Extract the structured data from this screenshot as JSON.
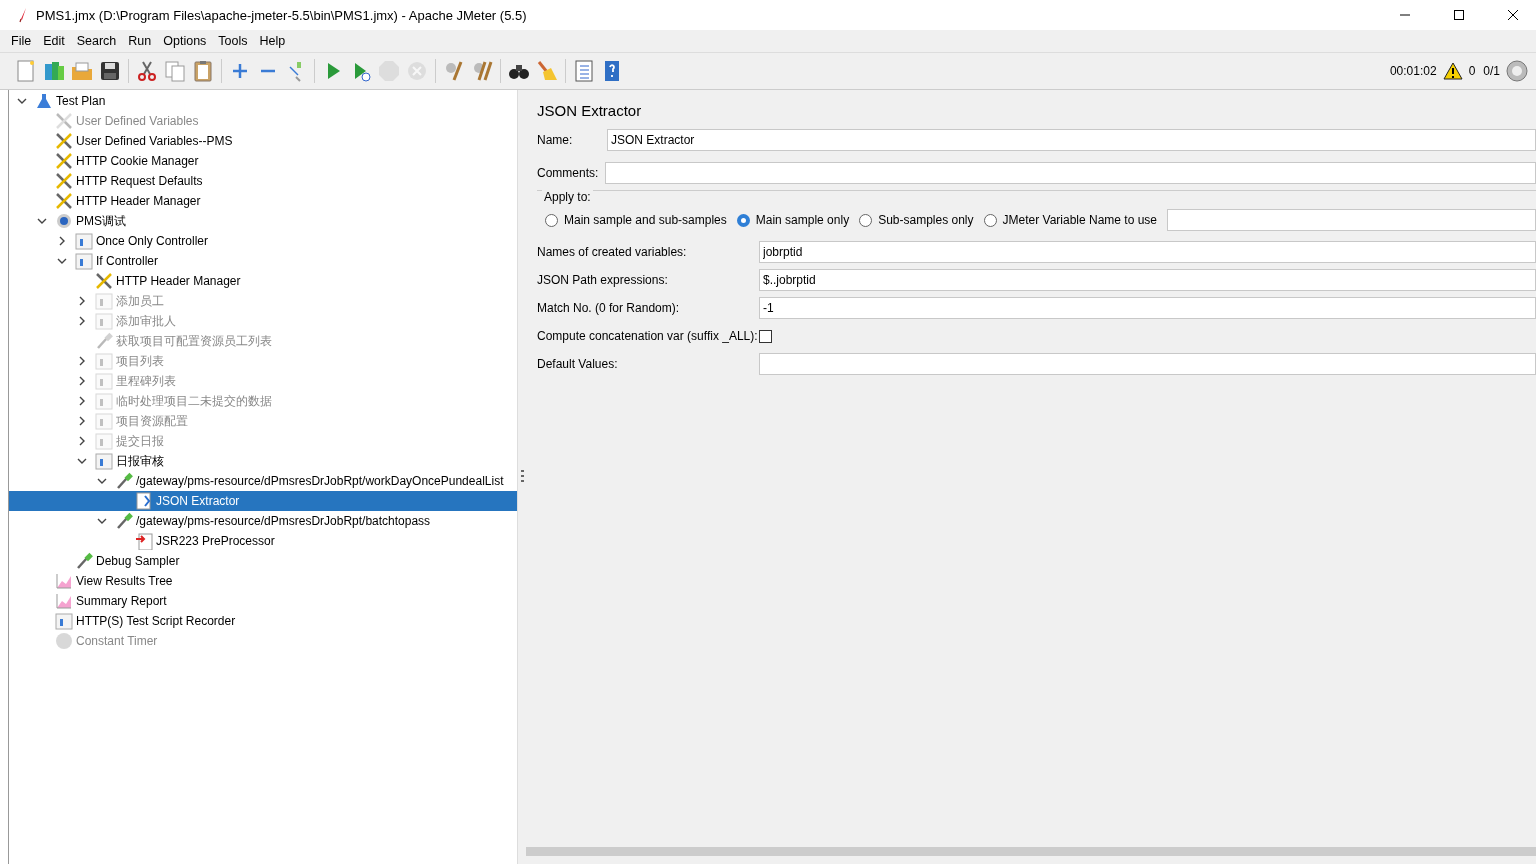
{
  "window": {
    "title": "PMS1.jmx (D:\\Program Files\\apache-jmeter-5.5\\bin\\PMS1.jmx) - Apache JMeter (5.5)"
  },
  "menu": [
    "File",
    "Edit",
    "Search",
    "Run",
    "Options",
    "Tools",
    "Help"
  ],
  "toolbar": [
    {
      "kind": "new",
      "disabled": false
    },
    {
      "kind": "templates",
      "disabled": false
    },
    {
      "kind": "open",
      "disabled": false
    },
    {
      "kind": "save",
      "disabled": false
    },
    {
      "kind": "sep"
    },
    {
      "kind": "cut",
      "disabled": false
    },
    {
      "kind": "copy",
      "disabled": false
    },
    {
      "kind": "paste",
      "disabled": false
    },
    {
      "kind": "sep"
    },
    {
      "kind": "expand",
      "disabled": false
    },
    {
      "kind": "collapse",
      "disabled": false
    },
    {
      "kind": "toggle",
      "disabled": false
    },
    {
      "kind": "sep"
    },
    {
      "kind": "start",
      "disabled": false
    },
    {
      "kind": "start-no-pause",
      "disabled": false
    },
    {
      "kind": "stop",
      "disabled": true
    },
    {
      "kind": "shutdown",
      "disabled": true
    },
    {
      "kind": "sep"
    },
    {
      "kind": "clear",
      "disabled": false
    },
    {
      "kind": "clear-all",
      "disabled": false
    },
    {
      "kind": "sep"
    },
    {
      "kind": "search",
      "disabled": false
    },
    {
      "kind": "reset",
      "disabled": false
    },
    {
      "kind": "sep"
    },
    {
      "kind": "functions",
      "disabled": false
    },
    {
      "kind": "help",
      "disabled": false
    }
  ],
  "status": {
    "elapsed": "00:01:02",
    "warnings": "0",
    "threads": "0/1"
  },
  "tree": [
    {
      "label": "Test Plan",
      "kind": "plan",
      "disabled": false,
      "selected": false,
      "expanded": true,
      "children": [
        {
          "label": "User Defined Variables",
          "kind": "config",
          "disabled": true,
          "selected": false
        },
        {
          "label": "User Defined Variables--PMS",
          "kind": "config",
          "disabled": false,
          "selected": false
        },
        {
          "label": "HTTP Cookie Manager",
          "kind": "config",
          "disabled": false,
          "selected": false
        },
        {
          "label": "HTTP Request Defaults",
          "kind": "config",
          "disabled": false,
          "selected": false
        },
        {
          "label": "HTTP Header Manager",
          "kind": "config",
          "disabled": false,
          "selected": false
        },
        {
          "label": "PMS调试",
          "kind": "threadgroup",
          "disabled": false,
          "selected": false,
          "expanded": true,
          "children": [
            {
              "label": "Once Only Controller",
              "kind": "controller",
              "disabled": false,
              "selected": false,
              "expanded": false
            },
            {
              "label": "If Controller",
              "kind": "controller",
              "disabled": false,
              "selected": false,
              "expanded": true,
              "children": [
                {
                  "label": "HTTP Header Manager",
                  "kind": "config",
                  "disabled": false,
                  "selected": false
                },
                {
                  "label": "添加员工",
                  "kind": "controller",
                  "disabled": true,
                  "selected": false,
                  "expanded": false
                },
                {
                  "label": "添加审批人",
                  "kind": "controller",
                  "disabled": true,
                  "selected": false,
                  "expanded": false
                },
                {
                  "label": "获取项目可配置资源员工列表",
                  "kind": "sampler",
                  "disabled": true,
                  "selected": false
                },
                {
                  "label": "项目列表",
                  "kind": "controller",
                  "disabled": true,
                  "selected": false,
                  "expanded": false
                },
                {
                  "label": "里程碑列表",
                  "kind": "controller",
                  "disabled": true,
                  "selected": false,
                  "expanded": false
                },
                {
                  "label": "临时处理项目二未提交的数据",
                  "kind": "controller",
                  "disabled": true,
                  "selected": false,
                  "expanded": false
                },
                {
                  "label": "项目资源配置",
                  "kind": "controller",
                  "disabled": true,
                  "selected": false,
                  "expanded": false
                },
                {
                  "label": "提交日报",
                  "kind": "controller",
                  "disabled": true,
                  "selected": false,
                  "expanded": false
                },
                {
                  "label": "日报审核",
                  "kind": "controller",
                  "disabled": false,
                  "selected": false,
                  "expanded": true,
                  "children": [
                    {
                      "label": "/gateway/pms-resource/dPmsresDrJobRpt/workDayOncePundealList",
                      "kind": "sampler",
                      "disabled": false,
                      "selected": false,
                      "expanded": true,
                      "children": [
                        {
                          "label": "JSON Extractor",
                          "kind": "extractor",
                          "disabled": false,
                          "selected": true
                        }
                      ]
                    },
                    {
                      "label": "/gateway/pms-resource/dPmsresDrJobRpt/batchtopass",
                      "kind": "sampler",
                      "disabled": false,
                      "selected": false,
                      "expanded": true,
                      "children": [
                        {
                          "label": "JSR223 PreProcessor",
                          "kind": "preprocessor",
                          "disabled": false,
                          "selected": false
                        }
                      ]
                    }
                  ]
                }
              ]
            },
            {
              "label": "Debug Sampler",
              "kind": "sampler",
              "disabled": false,
              "selected": false
            }
          ]
        },
        {
          "label": "View Results Tree",
          "kind": "listener",
          "disabled": false,
          "selected": false
        },
        {
          "label": "Summary Report",
          "kind": "listener",
          "disabled": false,
          "selected": false
        },
        {
          "label": "HTTP(S) Test Script Recorder",
          "kind": "controller",
          "disabled": false,
          "selected": false
        },
        {
          "label": "Constant Timer",
          "kind": "timer",
          "disabled": true,
          "selected": false
        }
      ]
    }
  ],
  "panel": {
    "title": "JSON Extractor",
    "name_label": "Name:",
    "name_value": "JSON Extractor",
    "comments_label": "Comments:",
    "apply_to": {
      "label": "Apply to:",
      "options": [
        {
          "label": "Main sample and sub-samples",
          "selected": false
        },
        {
          "label": "Main sample only",
          "selected": true
        },
        {
          "label": "Sub-samples only",
          "selected": false
        },
        {
          "label": "JMeter Variable Name to use",
          "selected": false
        }
      ]
    },
    "fields": [
      {
        "label": "Names of created variables:",
        "kind": "text",
        "value": "jobrptid"
      },
      {
        "label": "JSON Path expressions:",
        "kind": "text",
        "value": "$..jobrptid"
      },
      {
        "label": "Match No. (0 for Random):",
        "kind": "text",
        "value": "-1"
      },
      {
        "label": "Compute concatenation var (suffix _ALL):",
        "kind": "checkbox",
        "checked": false
      },
      {
        "label": "Default Values:",
        "kind": "text"
      }
    ]
  }
}
